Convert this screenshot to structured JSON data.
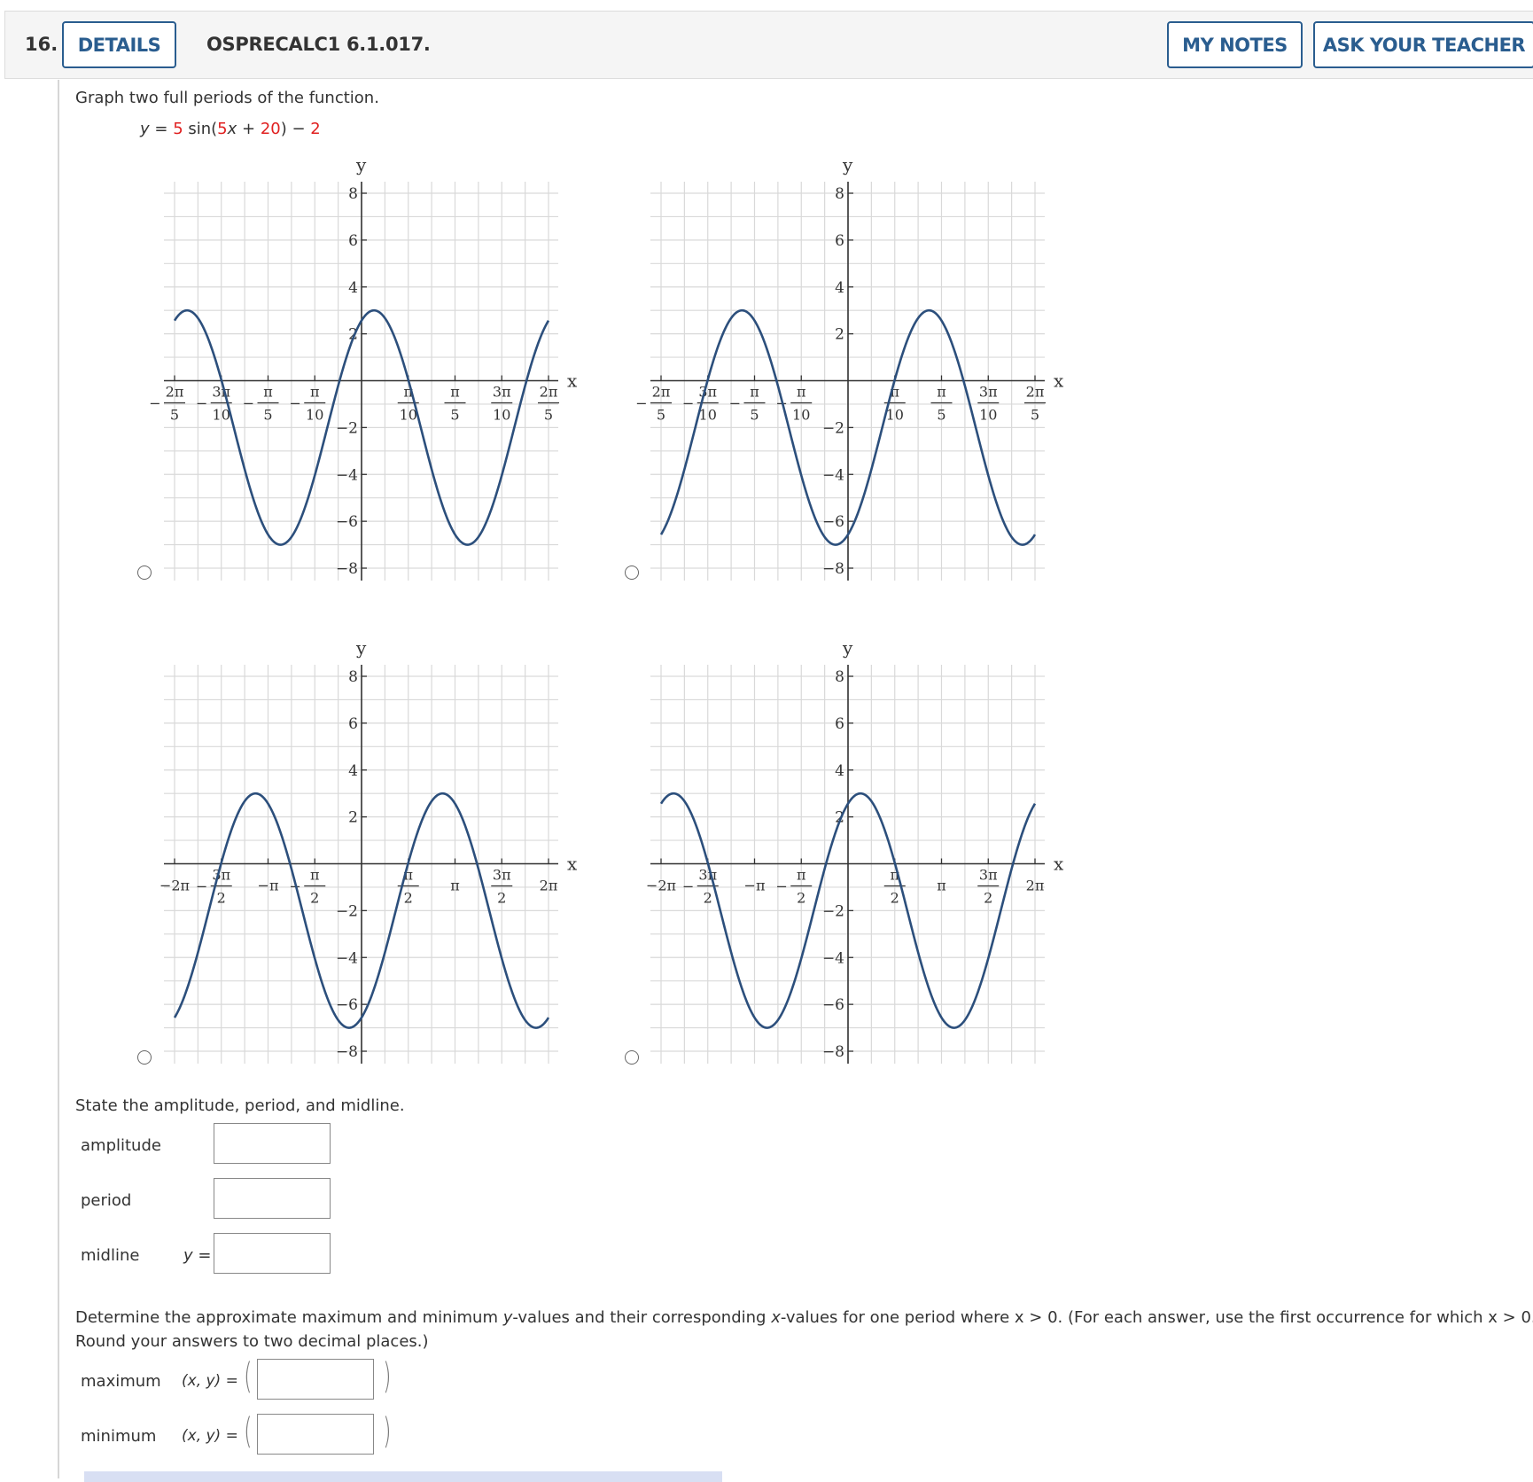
{
  "question": {
    "number": "16.",
    "details_label": "DETAILS",
    "code": "OSPRECALC1 6.1.017.",
    "my_notes_label": "MY NOTES",
    "ask_teacher_label": "ASK YOUR TEACHER",
    "accent_color": "#2a5d8f"
  },
  "prompt": {
    "instruction": "Graph two full periods of the function.",
    "equation": {
      "y": "y",
      "eq": " = ",
      "amp": "5",
      "sin": " sin(",
      "b": "5",
      "x": "x",
      "plus": " + ",
      "c": "20",
      "close": ") − ",
      "d": "2"
    },
    "highlight_color": "#e02020"
  },
  "chart_data": [
    {
      "type": "line",
      "name": "option-1",
      "selected": false,
      "xlabel": "x",
      "ylabel": "y",
      "xlim": [
        -1.2566,
        1.2566
      ],
      "ylim": [
        -8,
        8
      ],
      "x_ticks": [
        {
          "value": -1.2566,
          "num": "2π",
          "den": "5",
          "neg": true
        },
        {
          "value": -0.9425,
          "num": "3π",
          "den": "10",
          "neg": true
        },
        {
          "value": -0.6283,
          "num": "π",
          "den": "5",
          "neg": true
        },
        {
          "value": -0.3142,
          "num": "π",
          "den": "10",
          "neg": true
        },
        {
          "value": 0.3142,
          "num": "π",
          "den": "10",
          "neg": false
        },
        {
          "value": 0.6283,
          "num": "π",
          "den": "5",
          "neg": false
        },
        {
          "value": 0.9425,
          "num": "3π",
          "den": "10",
          "neg": false
        },
        {
          "value": 1.2566,
          "num": "2π",
          "den": "5",
          "neg": false
        }
      ],
      "y_ticks": [
        8,
        6,
        4,
        2,
        -2,
        -4,
        -6,
        -8
      ],
      "curve": {
        "amplitude": 5,
        "b": 5,
        "c": 20,
        "d": -2
      },
      "grid": true
    },
    {
      "type": "line",
      "name": "option-2",
      "selected": false,
      "xlabel": "x",
      "ylabel": "y",
      "xlim": [
        -1.2566,
        1.2566
      ],
      "ylim": [
        -8,
        8
      ],
      "x_ticks": [
        {
          "value": -1.2566,
          "num": "2π",
          "den": "5",
          "neg": true
        },
        {
          "value": -0.9425,
          "num": "3π",
          "den": "10",
          "neg": true
        },
        {
          "value": -0.6283,
          "num": "π",
          "den": "5",
          "neg": true
        },
        {
          "value": -0.3142,
          "num": "π",
          "den": "10",
          "neg": true
        },
        {
          "value": 0.3142,
          "num": "π",
          "den": "10",
          "neg": false
        },
        {
          "value": 0.6283,
          "num": "π",
          "den": "5",
          "neg": false
        },
        {
          "value": 0.9425,
          "num": "3π",
          "den": "10",
          "neg": false
        },
        {
          "value": 1.2566,
          "num": "2π",
          "den": "5",
          "neg": false
        }
      ],
      "y_ticks": [
        8,
        6,
        4,
        2,
        -2,
        -4,
        -6,
        -8
      ],
      "curve": {
        "amplitude": 5,
        "b": 5,
        "c": -20,
        "d": -2
      },
      "grid": true
    },
    {
      "type": "line",
      "name": "option-3",
      "selected": false,
      "xlabel": "x",
      "ylabel": "y",
      "xlim": [
        -6.2832,
        6.2832
      ],
      "ylim": [
        -8,
        8
      ],
      "x_ticks": [
        {
          "value": -6.2832,
          "label": "−2π"
        },
        {
          "value": -4.7124,
          "num": "3π",
          "den": "2",
          "neg": true
        },
        {
          "value": -3.1416,
          "label": "−π"
        },
        {
          "value": -1.5708,
          "num": "π",
          "den": "2",
          "neg": true
        },
        {
          "value": 1.5708,
          "num": "π",
          "den": "2",
          "neg": false
        },
        {
          "value": 3.1416,
          "label": "π"
        },
        {
          "value": 4.7124,
          "num": "3π",
          "den": "2",
          "neg": false
        },
        {
          "value": 6.2832,
          "label": "2π"
        }
      ],
      "y_ticks": [
        8,
        6,
        4,
        2,
        -2,
        -4,
        -6,
        -8
      ],
      "curve": {
        "amplitude": 5,
        "b": 1,
        "c": -20,
        "d": -2
      },
      "grid": true
    },
    {
      "type": "line",
      "name": "option-4",
      "selected": false,
      "xlabel": "x",
      "ylabel": "y",
      "xlim": [
        -6.2832,
        6.2832
      ],
      "ylim": [
        -8,
        8
      ],
      "x_ticks": [
        {
          "value": -6.2832,
          "label": "−2π"
        },
        {
          "value": -4.7124,
          "num": "3π",
          "den": "2",
          "neg": true
        },
        {
          "value": -3.1416,
          "label": "−π"
        },
        {
          "value": -1.5708,
          "num": "π",
          "den": "2",
          "neg": true
        },
        {
          "value": 1.5708,
          "num": "π",
          "den": "2",
          "neg": false
        },
        {
          "value": 3.1416,
          "label": "π"
        },
        {
          "value": 4.7124,
          "num": "3π",
          "den": "2",
          "neg": false
        },
        {
          "value": 6.2832,
          "label": "2π"
        }
      ],
      "y_ticks": [
        8,
        6,
        4,
        2,
        -2,
        -4,
        -6,
        -8
      ],
      "curve": {
        "amplitude": 5,
        "b": 1,
        "c": 20,
        "d": -2
      },
      "grid": true
    }
  ],
  "curve_color": "#2c4f7c",
  "part2": {
    "instruction": "State the amplitude, period, and midline.",
    "amplitude_label": "amplitude",
    "period_label": "period",
    "midline_label": "midline",
    "midline_prefix": "y =",
    "amplitude_value": "",
    "period_value": "",
    "midline_value": ""
  },
  "part3": {
    "instruction_line1_a": "Determine the approximate maximum and minimum ",
    "instruction_line1_y": "y",
    "instruction_line1_b": "-values and their corresponding ",
    "instruction_line1_x": "x",
    "instruction_line1_c": "-values for one period where  ",
    "instruction_cond1": "x > 0.",
    "instruction_line1_d": "  (For each answer, use the first occurrence for which  ",
    "instruction_cond2": "x > 0.",
    "instruction_line2": "Round your answers to two decimal places.)",
    "maximum_label": "maximum",
    "minimum_label": "minimum",
    "xy_label": "(x, y) =",
    "maximum_value": "",
    "minimum_value": ""
  }
}
